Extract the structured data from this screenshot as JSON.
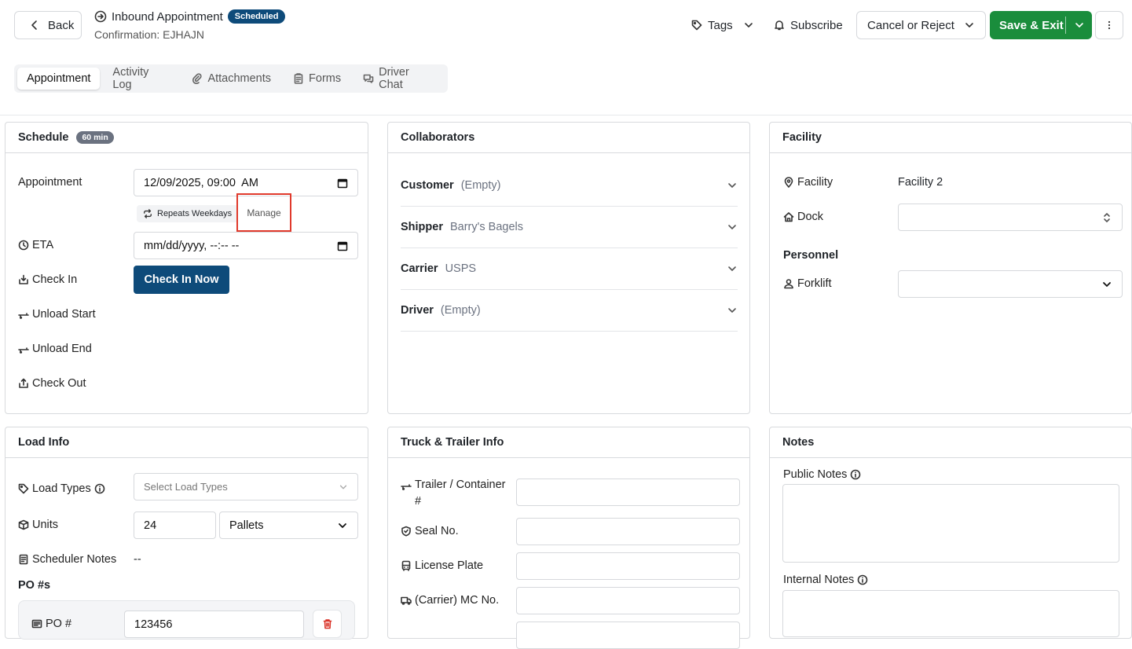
{
  "header": {
    "back_label": "Back",
    "title": "Inbound Appointment",
    "status_badge": "Scheduled",
    "confirmation": "Confirmation: EJHAJN",
    "tags_label": "Tags",
    "subscribe_label": "Subscribe",
    "cancel_label": "Cancel or Reject",
    "save_label": "Save & Exit"
  },
  "tabs": [
    {
      "label": "Appointment",
      "active": true
    },
    {
      "label": "Activity Log"
    },
    {
      "label": "Attachments"
    },
    {
      "label": "Forms"
    },
    {
      "label": "Driver Chat"
    }
  ],
  "schedule": {
    "title": "Schedule",
    "duration_badge": "60 min",
    "appointment_label": "Appointment",
    "appointment_value": "12/09/2025, 09:00  AM",
    "repeats_label": "Repeats Weekdays",
    "manage_label": "Manage",
    "eta_label": "ETA",
    "eta_placeholder": "mm/dd/yyyy, --:-- --",
    "checkin_label": "Check In",
    "checkin_button": "Check In Now",
    "unload_start_label": "Unload Start",
    "unload_end_label": "Unload End",
    "checkout_label": "Check Out"
  },
  "collaborators": {
    "title": "Collaborators",
    "rows": [
      {
        "key": "Customer",
        "value": "(Empty)"
      },
      {
        "key": "Shipper",
        "value": "Barry's Bagels"
      },
      {
        "key": "Carrier",
        "value": "USPS"
      },
      {
        "key": "Driver",
        "value": "(Empty)"
      }
    ]
  },
  "facility": {
    "title": "Facility",
    "facility_label": "Facility",
    "facility_value": "Facility 2",
    "dock_label": "Dock",
    "personnel_heading": "Personnel",
    "forklift_label": "Forklift"
  },
  "load_info": {
    "title": "Load Info",
    "load_types_label": "Load Types",
    "load_types_placeholder": "Select Load Types",
    "units_label": "Units",
    "units_value": "24",
    "units_type": "Pallets",
    "scheduler_notes_label": "Scheduler Notes",
    "scheduler_notes_value": "--",
    "po_heading": "PO #s",
    "po_label": "PO #",
    "po_value": "123456"
  },
  "truck": {
    "title": "Truck & Trailer Info",
    "trailer_label": "Trailer / Container #",
    "seal_label": "Seal No.",
    "plate_label": "License Plate",
    "mc_label": "(Carrier) MC No."
  },
  "notes": {
    "title": "Notes",
    "public_label": "Public Notes",
    "internal_label": "Internal Notes"
  }
}
